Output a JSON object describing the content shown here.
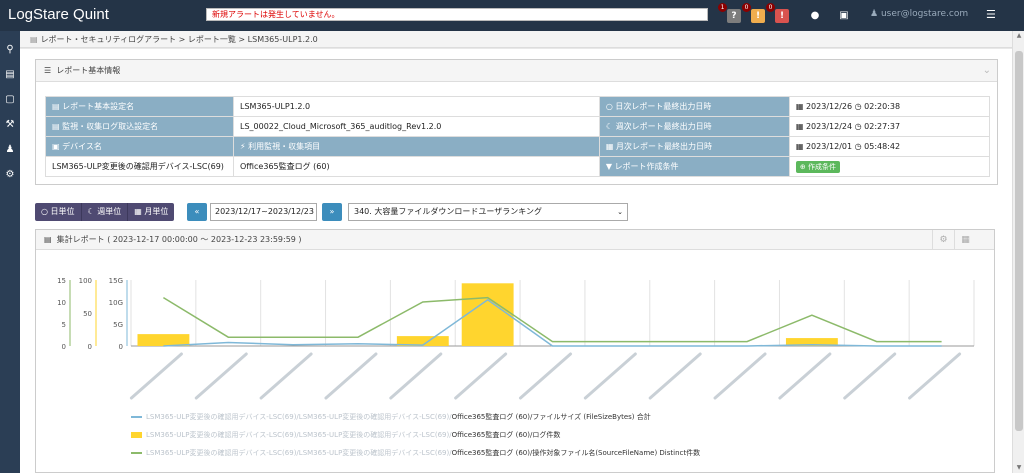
{
  "app": {
    "title": "LogStare Quint",
    "alert_text": "新規アラートは発生していません。",
    "badges": [
      {
        "count": "1",
        "icon": "?",
        "color": "#7d7d7d"
      },
      {
        "count": "0",
        "icon": "!",
        "color": "#f0ad4e"
      },
      {
        "count": "0",
        "icon": "!",
        "color": "#d9534f"
      }
    ],
    "user_label": "user@logstare.com"
  },
  "breadcrumb": "レポート・セキュリティログアラート > レポート一覧 > LSM365-ULP1.2.0",
  "panel_basic": {
    "title": "レポート基本情報",
    "rows": [
      {
        "label1": "レポート基本設定名",
        "value1": "LSM365-ULP1.2.0",
        "label2": "日次レポート最終出力日時",
        "date2": "2023/12/26",
        "time2": "02:20:38"
      },
      {
        "label1": "監視・収集ログ取込設定名",
        "value1": "LS_00022_Cloud_Microsoft_365_auditlog_Rev1.2.0",
        "label2": "週次レポート最終出力日時",
        "date2": "2023/12/24",
        "time2": "02:27:37"
      },
      {
        "label1": "デバイス名",
        "value1": "利用監視・収集項目",
        "label2": "月次レポート最終出力日時",
        "date2": "2023/12/01",
        "time2": "05:48:42"
      }
    ],
    "row4": {
      "device": "LSM365-ULP変更後の確認用デバイス-LSC(69)",
      "item": "Office365監査ログ (60)",
      "label": "レポート作成条件",
      "button": "作成条件"
    }
  },
  "toolbar": {
    "units": [
      "日単位",
      "週単位",
      "月単位"
    ],
    "date_range": "2023/12/17~2023/12/23",
    "report_select": "340.   大容量ファイルダウンロードユーザランキング"
  },
  "aggregate": {
    "title": "集計レポート ( 2023-12-17 00:00:00 ～ 2023-12-23 23:59:59 )"
  },
  "chart_data": {
    "type": "bar",
    "categories": [
      "",
      "",
      "",
      "",
      "",
      "",
      "",
      "",
      "",
      "",
      "",
      "",
      ""
    ],
    "y_left_ticks": [
      "15",
      "10",
      "5",
      "0"
    ],
    "y_mid_ticks": [
      "100",
      "50",
      "0"
    ],
    "y_right_ticks": [
      "15G",
      "10G",
      "5G",
      "0"
    ],
    "ylim_left": [
      0,
      15
    ],
    "ylim_right": [
      0,
      15
    ],
    "series": [
      {
        "name": "Office365監査ログ (60)/ファイルサイズ (FileSizeBytes) 合計",
        "type": "line",
        "color": "#7fb8d8",
        "axis": "right",
        "values": [
          0,
          0.8,
          0.3,
          0.5,
          0.2,
          10.5,
          0,
          0,
          0,
          0,
          0.3,
          0,
          0
        ]
      },
      {
        "name": "Office365監査ログ (60)/ログ件数",
        "type": "bar",
        "color": "#ffd52e",
        "axis": "mid",
        "values": [
          18,
          0,
          0,
          0,
          15,
          95,
          0,
          0,
          0,
          0,
          12,
          0,
          0
        ]
      },
      {
        "name": "Office365監査ログ (60)/操作対象ファイル名(SourceFileName) Distinct件数",
        "type": "line",
        "color": "#8cba6a",
        "axis": "left",
        "values": [
          11,
          2,
          2,
          2,
          10,
          11,
          1,
          1,
          1,
          1,
          7,
          1,
          1
        ]
      }
    ],
    "legend_prefix": "LSM365-ULP変更後の確認用デバイス-LSC(69)/LSM365-ULP変更後の確認用デバイス-LSC(69)/",
    "grid": true,
    "legend_position": "bottom"
  }
}
